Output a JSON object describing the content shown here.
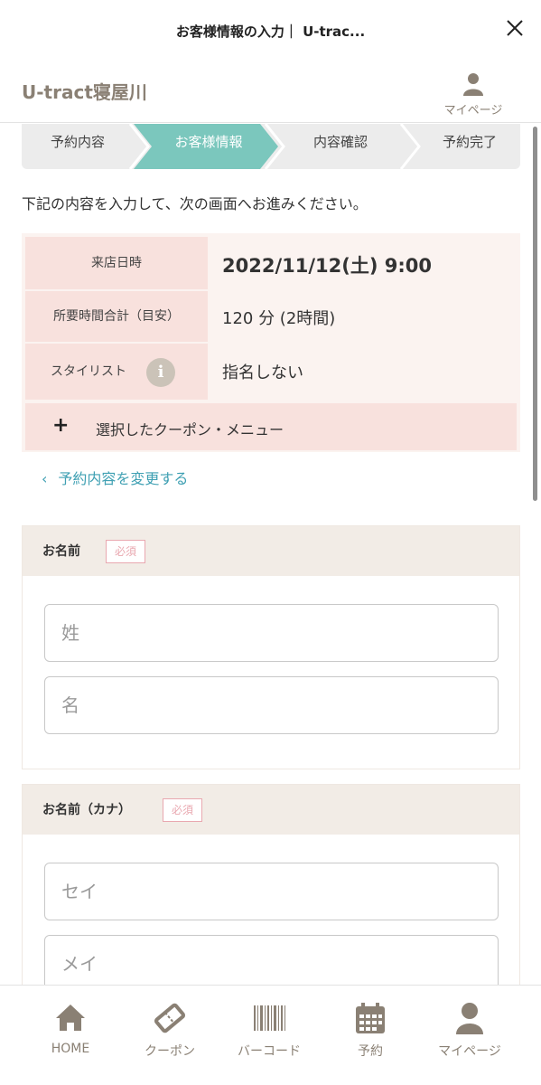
{
  "window": {
    "title": "お客様情報の入力｜ U-trac..."
  },
  "header": {
    "brand": "U-tract寝屋川",
    "mypage_label": "マイページ"
  },
  "steps": [
    "予約内容",
    "お客様情報",
    "内容確認",
    "予約完了"
  ],
  "active_step": 1,
  "intro_text": "下記の内容を入力して、次の画面へお進みください。",
  "info": {
    "visit_label": "来店日時",
    "visit_value": "2022/11/12(土) 9:00",
    "duration_label": "所要時間合計（目安）",
    "duration_value": "120 分 (2時間)",
    "stylist_label": "スタイリスト",
    "stylist_info_icon": "info-icon",
    "stylist_value": "指名しない",
    "coupon_toggle": "+",
    "coupon_text": "選択したクーポン・メニュー"
  },
  "change_link": {
    "chevron": "‹",
    "label": "予約内容を変更する"
  },
  "name_section": {
    "title": "お名前",
    "required": "必須",
    "last_placeholder": "姓",
    "first_placeholder": "名"
  },
  "kana_section": {
    "title": "お名前（カナ）",
    "required": "必須",
    "last_placeholder": "セイ",
    "first_placeholder": "メイ"
  },
  "nav": [
    {
      "label": "HOME",
      "icon": "home-icon"
    },
    {
      "label": "クーポン",
      "icon": "ticket-icon"
    },
    {
      "label": "バーコード",
      "icon": "barcode-icon"
    },
    {
      "label": "予約",
      "icon": "calendar-icon"
    },
    {
      "label": "マイページ",
      "icon": "person-icon"
    }
  ],
  "colors": {
    "accent": "#7bc7bd",
    "brand": "#8a8074",
    "link": "#3fa0b3",
    "required": "#e9a8b0",
    "info_bg": "#fbf3f0",
    "info_label_bg": "#f8e1dd"
  }
}
